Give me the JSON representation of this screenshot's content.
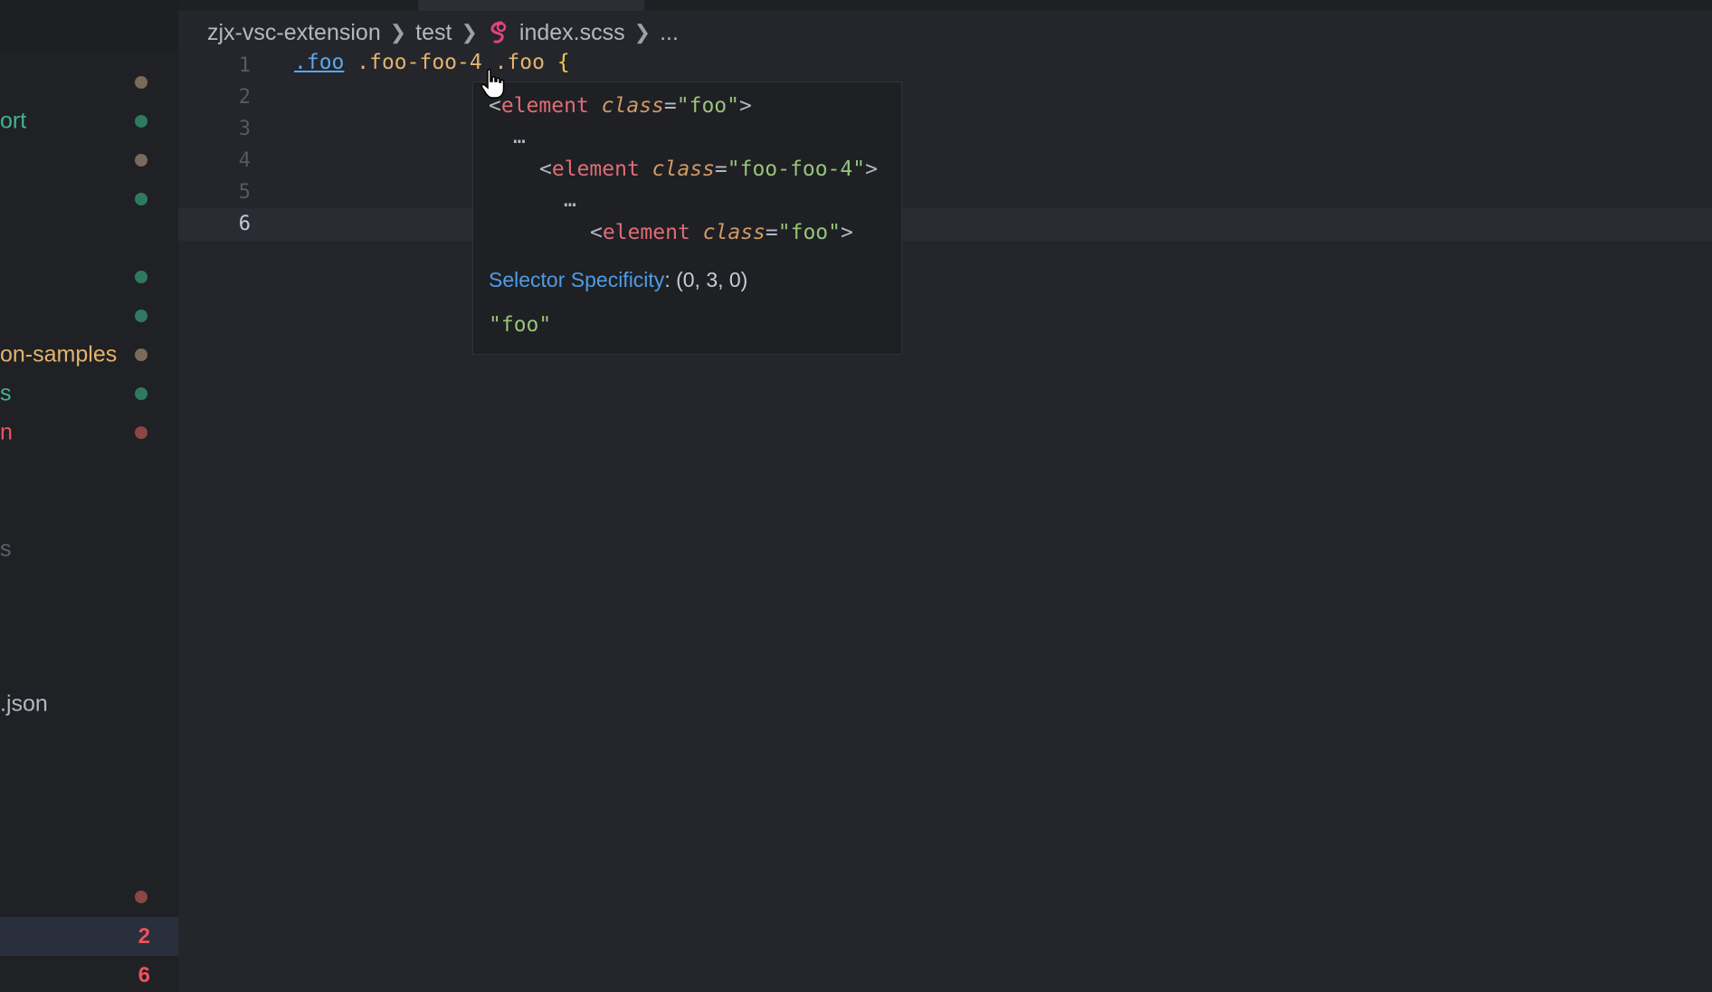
{
  "sidebar": {
    "items": [
      {
        "label": "",
        "color": "#8a8a8a",
        "dot": "#8b7b6a"
      },
      {
        "label": "ort",
        "color": "#3fb68b",
        "dot": "#2f7a5e"
      },
      {
        "label": "",
        "color": "#8a8a8a",
        "dot": "#8b7b6a"
      },
      {
        "label": "",
        "color": "#3fb68b",
        "dot": "#2f7a5e"
      },
      {
        "label": "",
        "color": "#3fb68b",
        "dot": "#2f7a5e"
      },
      {
        "label": "",
        "color": "#3fb68b",
        "dot": "#2f7a5e"
      },
      {
        "label": "on-samples",
        "color": "#e4b36d",
        "dot": "#8b7b6a"
      },
      {
        "label": "s",
        "color": "#3fb68b",
        "dot": "#2f7a5e"
      },
      {
        "label": "n",
        "color": "#f0515a",
        "dot": "#8c4646"
      },
      {
        "label": "s",
        "color": "#5a6070",
        "dot": ""
      },
      {
        "label": ".json",
        "color": "#b3b8c2",
        "dot": ""
      },
      {
        "label": "",
        "color": "#f0515a",
        "dot": "#8c4646"
      }
    ],
    "counts": [
      "2",
      "6"
    ]
  },
  "breadcrumb": {
    "root": "zjx-vsc-extension",
    "folder": "test",
    "file": "index.scss",
    "more": "..."
  },
  "gutter": [
    "1",
    "2",
    "3",
    "4",
    "5",
    "6"
  ],
  "code": {
    "dot": ".",
    "sel1": "foo",
    "rest": " .foo-foo-4 .foo ",
    "brace": "{"
  },
  "hover": {
    "tag_open": "<",
    "tag_name": "element",
    "attr_name": "class",
    "eq": "=",
    "tag_close": ">",
    "class1": "\"foo\"",
    "class2": "\"foo-foo-4\"",
    "class3": "\"foo\"",
    "ellipsis": "…",
    "spec_label": "Selector Specificity",
    "spec_value": ": (0, 3, 0)",
    "string_value": "\"foo\""
  }
}
